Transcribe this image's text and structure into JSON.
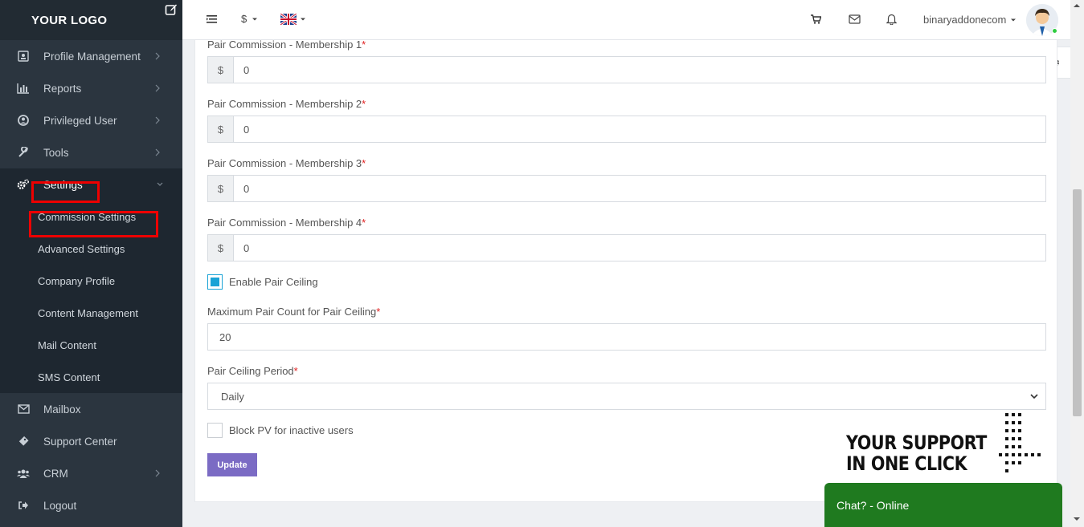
{
  "logo": "YOUR LOGO",
  "sidebar": {
    "items": [
      {
        "label": "Profile Management",
        "icon": "id-card-icon"
      },
      {
        "label": "Reports",
        "icon": "bar-chart-icon"
      },
      {
        "label": "Privileged User",
        "icon": "user-circle-icon"
      },
      {
        "label": "Tools",
        "icon": "wrench-icon"
      },
      {
        "label": "Settings",
        "icon": "cogs-icon"
      },
      {
        "label": "Mailbox",
        "icon": "envelope-icon"
      },
      {
        "label": "Support Center",
        "icon": "ticket-icon"
      },
      {
        "label": "CRM",
        "icon": "users-icon"
      },
      {
        "label": "Logout",
        "icon": "sign-out-icon"
      }
    ],
    "settings_submenu": [
      "Commission Settings",
      "Advanced Settings",
      "Company Profile",
      "Content Management",
      "Mail Content",
      "SMS Content"
    ]
  },
  "topbar": {
    "currency": "$",
    "username": "binaryaddonecom"
  },
  "form": {
    "fields": [
      {
        "label": "Pair Commission - Membership 1",
        "addon": "$",
        "value": "0"
      },
      {
        "label": "Pair Commission - Membership 2",
        "addon": "$",
        "value": "0"
      },
      {
        "label": "Pair Commission - Membership 3",
        "addon": "$",
        "value": "0"
      },
      {
        "label": "Pair Commission - Membership 4",
        "addon": "$",
        "value": "0"
      }
    ],
    "required_mark": "*",
    "enable_pair_ceiling": {
      "label": "Enable Pair Ceiling",
      "checked": true
    },
    "max_pair_count": {
      "label": "Maximum Pair Count for Pair Ceiling",
      "value": "20"
    },
    "pair_ceiling_period": {
      "label": "Pair Ceiling Period",
      "value": "Daily"
    },
    "block_pv": {
      "label": "Block PV for inactive users",
      "checked": false
    },
    "update_button": "Update"
  },
  "support_badge": {
    "line1": "YOUR SUPPORT",
    "line2": "IN ONE CLICK"
  },
  "chat": {
    "label": "Chat? - Online"
  },
  "colors": {
    "sidebar": "#2b353f",
    "accent": "#7b6bc4",
    "checkbox": "#1aa3d6",
    "chat": "#1f7a1f",
    "highlight": "#ee0000"
  }
}
